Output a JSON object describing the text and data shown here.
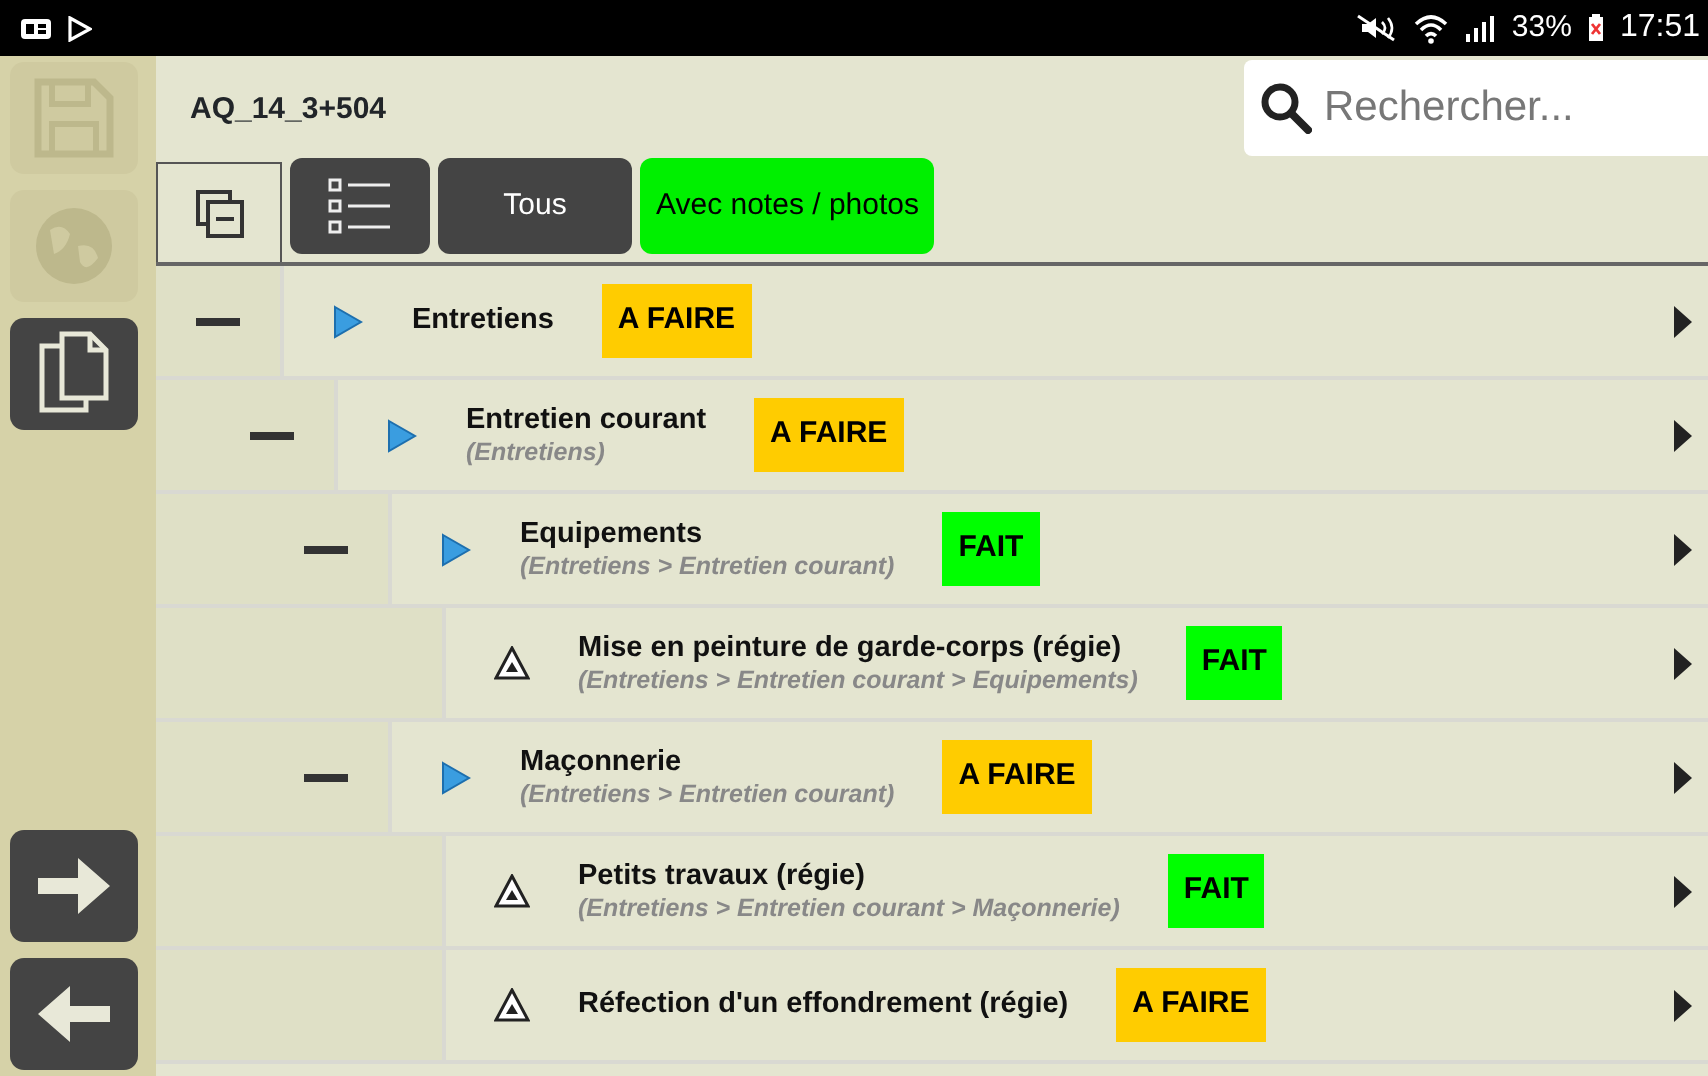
{
  "status_bar": {
    "battery_text": "33%",
    "time": "17:51"
  },
  "sidebar": {
    "items": [
      {
        "kind": "save",
        "disabled": true
      },
      {
        "kind": "globe",
        "disabled": true
      },
      {
        "kind": "copy",
        "disabled": false
      }
    ],
    "bottom_items": [
      {
        "kind": "next"
      },
      {
        "kind": "back"
      }
    ]
  },
  "header": {
    "title": "AQ_14_3+504",
    "search": {
      "placeholder": "Rechercher..."
    }
  },
  "toolbar": {
    "filters": [
      {
        "label": "Tous",
        "selected": false
      },
      {
        "label": "Avec notes / photos",
        "selected": true
      }
    ]
  },
  "tree": [
    {
      "kind": "group",
      "title": "Entretiens",
      "status": {
        "label": "A FAIRE",
        "color": "#ffcc00"
      },
      "children": [
        {
          "kind": "group",
          "title": "Entretien courant",
          "path": "(Entretiens)",
          "status": {
            "label": "A FAIRE",
            "color": "#ffcc00"
          },
          "children": [
            {
              "kind": "group",
              "title": "Equipements",
              "path": "(Entretiens > Entretien courant)",
              "status": {
                "label": "FAIT",
                "color": "#00ff00"
              },
              "children": [
                {
                  "kind": "task",
                  "title": "Mise en peinture de garde-corps (régie)",
                  "path": "(Entretiens > Entretien courant > Equipements)",
                  "status": {
                    "label": "FAIT",
                    "color": "#00ff00"
                  }
                }
              ]
            },
            {
              "kind": "group",
              "title": "Maçonnerie",
              "path": "(Entretiens > Entretien courant)",
              "status": {
                "label": "A FAIRE",
                "color": "#ffcc00"
              },
              "children": [
                {
                  "kind": "task",
                  "title": "Petits travaux (régie)",
                  "path": "(Entretiens > Entretien courant > Maçonnerie)",
                  "status": {
                    "label": "FAIT",
                    "color": "#00ff00"
                  }
                },
                {
                  "kind": "task",
                  "title": "Réfection d'un effondrement (régie)",
                  "status": {
                    "label": "A FAIRE",
                    "color": "#ffcc00"
                  }
                }
              ]
            }
          ]
        }
      ]
    }
  ]
}
